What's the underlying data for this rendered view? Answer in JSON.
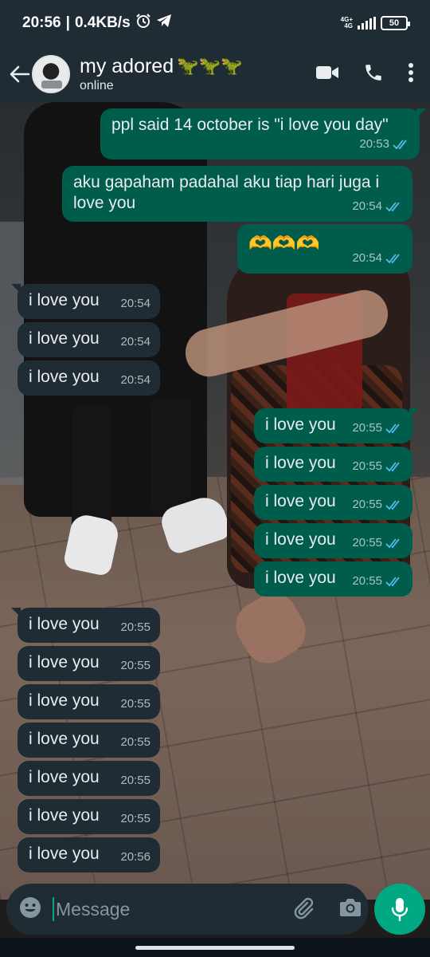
{
  "status_bar": {
    "time": "20:56",
    "separator": "|",
    "speed": "0.4KB/s",
    "network_type": "4G+",
    "network_sub": "4G",
    "battery": "50"
  },
  "header": {
    "contact_name": "my adored",
    "name_emojis": [
      "🦖",
      "🦖",
      "🦖"
    ],
    "status": "online"
  },
  "messages": [
    {
      "dir": "out",
      "text": "ppl said 14 october is \"i love you day\"",
      "time": "20:53"
    },
    {
      "dir": "out",
      "text": "aku gapaham padahal aku tiap hari juga i love you",
      "time": "20:54"
    },
    {
      "dir": "out",
      "text": "🫶🫶🫶",
      "time": "20:54"
    },
    {
      "dir": "in",
      "text": "i love you",
      "time": "20:54"
    },
    {
      "dir": "in",
      "text": "i love you",
      "time": "20:54"
    },
    {
      "dir": "in",
      "text": "i love you",
      "time": "20:54"
    },
    {
      "dir": "out",
      "text": "i love you",
      "time": "20:55"
    },
    {
      "dir": "out",
      "text": "i love you",
      "time": "20:55"
    },
    {
      "dir": "out",
      "text": "i love you",
      "time": "20:55"
    },
    {
      "dir": "out",
      "text": "i love you",
      "time": "20:55"
    },
    {
      "dir": "out",
      "text": "i love you",
      "time": "20:55"
    },
    {
      "dir": "in",
      "text": "i love you",
      "time": "20:55"
    },
    {
      "dir": "in",
      "text": "i love you",
      "time": "20:55"
    },
    {
      "dir": "in",
      "text": "i love you",
      "time": "20:55"
    },
    {
      "dir": "in",
      "text": "i love you",
      "time": "20:55"
    },
    {
      "dir": "in",
      "text": "i love you",
      "time": "20:55"
    },
    {
      "dir": "in",
      "text": "i love you",
      "time": "20:55"
    },
    {
      "dir": "in",
      "text": "i love you",
      "time": "20:56"
    }
  ],
  "composer": {
    "placeholder": "Message"
  },
  "icons": {
    "back": "arrow-left-icon",
    "video": "video-camera-icon",
    "call": "phone-icon",
    "menu": "more-vertical-icon",
    "emoji": "emoji-icon",
    "attach": "paperclip-icon",
    "camera": "camera-icon",
    "mic": "microphone-icon",
    "read": "double-check-icon"
  },
  "colors": {
    "header_bg": "#1f2c34",
    "outgoing_bubble": "#005c4b",
    "incoming_bubble": "#1f2c34",
    "accent": "#00a884",
    "read_tick": "#53bdeb"
  }
}
